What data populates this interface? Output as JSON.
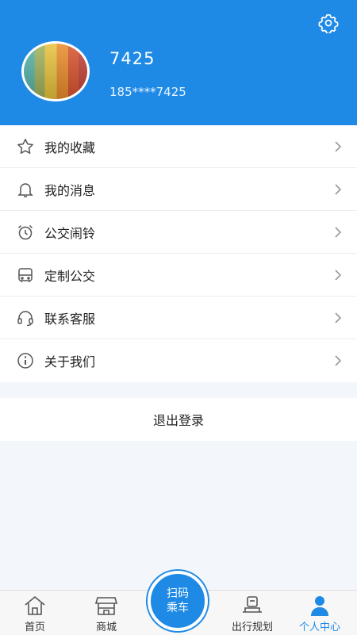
{
  "header": {
    "username": "7425",
    "phone": "185****7425"
  },
  "menu": {
    "items": [
      {
        "label": "我的收藏",
        "icon": "star-icon"
      },
      {
        "label": "我的消息",
        "icon": "bell-icon"
      },
      {
        "label": "公交闹铃",
        "icon": "alarm-clock-icon"
      },
      {
        "label": "定制公交",
        "icon": "bus-icon"
      },
      {
        "label": "联系客服",
        "icon": "headset-icon"
      },
      {
        "label": "关于我们",
        "icon": "info-icon"
      }
    ]
  },
  "logout_label": "退出登录",
  "tabbar": {
    "tabs": [
      {
        "label": "首页",
        "icon": "home-icon"
      },
      {
        "label": "商城",
        "icon": "shop-icon"
      },
      {
        "label": "出行规划",
        "icon": "trip-icon"
      },
      {
        "label": "个人中心",
        "icon": "person-icon"
      }
    ],
    "scan_line1": "扫码",
    "scan_line2": "乘车",
    "active_tab": "个人中心"
  },
  "colors": {
    "primary": "#1e8ae6",
    "background": "#f3f6fb"
  }
}
